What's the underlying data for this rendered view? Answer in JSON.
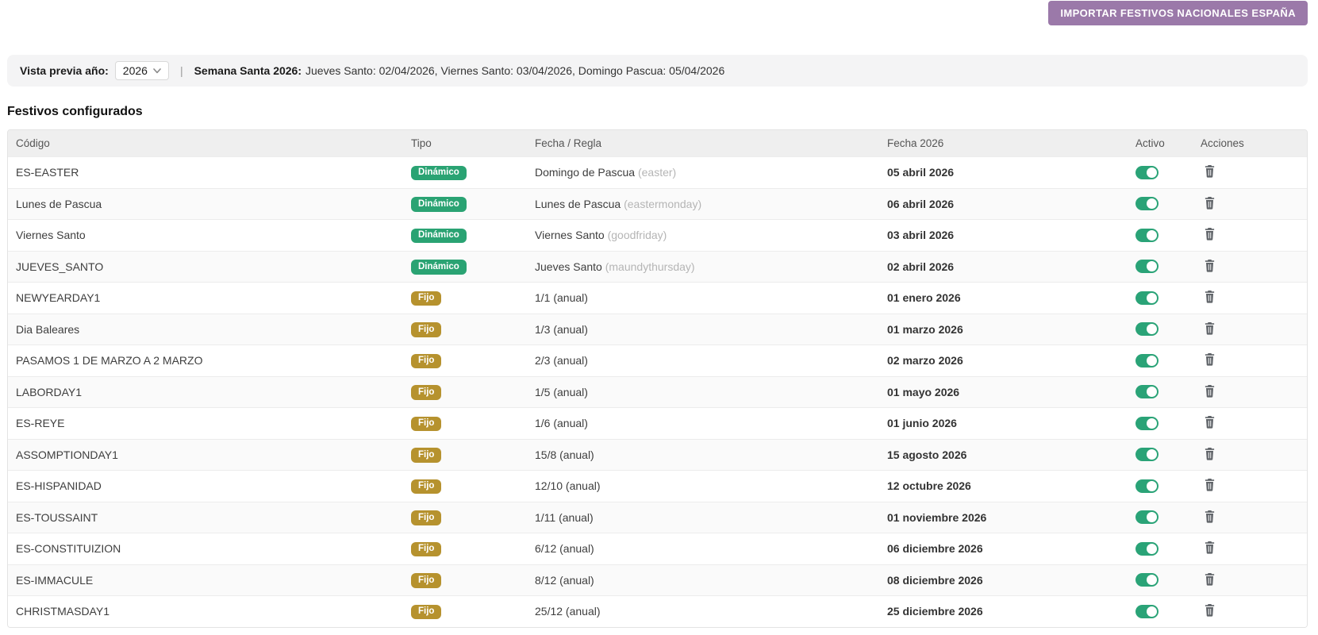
{
  "import_button": {
    "label": "IMPORTAR FESTIVOS NACIONALES ESPAÑA"
  },
  "preview": {
    "label": "Vista previa año:",
    "year": "2026",
    "separator": "|",
    "semana_santa_label": "Semana Santa 2026:",
    "semana_santa_text": "Jueves Santo: 02/04/2026, Viernes Santo: 03/04/2026, Domingo Pascua: 05/04/2026"
  },
  "section_title": "Festivos configurados",
  "table": {
    "headers": [
      "Código",
      "Tipo",
      "Fecha / Regla",
      "Fecha 2026",
      "Activo",
      "Acciones"
    ],
    "rows": [
      {
        "code": "ES-EASTER",
        "badge": {
          "label": "Dinámico",
          "style": "dinamico"
        },
        "rule": "Domingo de Pascua",
        "hint": "(easter)",
        "date": "05 abril 2026",
        "active": true
      },
      {
        "code": "Lunes de Pascua",
        "badge": {
          "label": "Dinámico",
          "style": "dinamico"
        },
        "rule": "Lunes de Pascua",
        "hint": "(eastermonday)",
        "date": "06 abril 2026",
        "active": true
      },
      {
        "code": "Viernes Santo",
        "badge": {
          "label": "Dinámico",
          "style": "dinamico"
        },
        "rule": "Viernes Santo",
        "hint": "(goodfriday)",
        "date": "03 abril 2026",
        "active": true
      },
      {
        "code": "JUEVES_SANTO",
        "badge": {
          "label": "Dinámico",
          "style": "dinamico"
        },
        "rule": "Jueves Santo",
        "hint": "(maundythursday)",
        "date": "02 abril 2026",
        "active": true
      },
      {
        "code": "NEWYEARDAY1",
        "badge": {
          "label": "Fijo",
          "style": "fijo"
        },
        "rule": "1/1 (anual)",
        "hint": "",
        "date": "01 enero 2026",
        "active": true
      },
      {
        "code": "Dia Baleares",
        "badge": {
          "label": "Fijo",
          "style": "fijo"
        },
        "rule": "1/3 (anual)",
        "hint": "",
        "date": "01 marzo 2026",
        "active": true
      },
      {
        "code": "PASAMOS 1 DE MARZO A 2 MARZO",
        "badge": {
          "label": "Fijo",
          "style": "fijo"
        },
        "rule": "2/3 (anual)",
        "hint": "",
        "date": "02 marzo 2026",
        "active": true
      },
      {
        "code": "LABORDAY1",
        "badge": {
          "label": "Fijo",
          "style": "fijo"
        },
        "rule": "1/5 (anual)",
        "hint": "",
        "date": "01 mayo 2026",
        "active": true
      },
      {
        "code": "ES-REYE",
        "badge": {
          "label": "Fijo",
          "style": "fijo"
        },
        "rule": "1/6 (anual)",
        "hint": "",
        "date": "01 junio 2026",
        "active": true
      },
      {
        "code": "ASSOMPTIONDAY1",
        "badge": {
          "label": "Fijo",
          "style": "fijo"
        },
        "rule": "15/8 (anual)",
        "hint": "",
        "date": "15 agosto 2026",
        "active": true
      },
      {
        "code": "ES-HISPANIDAD",
        "badge": {
          "label": "Fijo",
          "style": "fijo"
        },
        "rule": "12/10 (anual)",
        "hint": "",
        "date": "12 octubre 2026",
        "active": true
      },
      {
        "code": "ES-TOUSSAINT",
        "badge": {
          "label": "Fijo",
          "style": "fijo"
        },
        "rule": "1/11 (anual)",
        "hint": "",
        "date": "01 noviembre 2026",
        "active": true
      },
      {
        "code": "ES-CONSTITUIZION",
        "badge": {
          "label": "Fijo",
          "style": "fijo"
        },
        "rule": "6/12 (anual)",
        "hint": "",
        "date": "06 diciembre 2026",
        "active": true
      },
      {
        "code": "ES-IMMACULE",
        "badge": {
          "label": "Fijo",
          "style": "fijo"
        },
        "rule": "8/12 (anual)",
        "hint": "",
        "date": "08 diciembre 2026",
        "active": true
      },
      {
        "code": "CHRISTMASDAY1",
        "badge": {
          "label": "Fijo",
          "style": "fijo"
        },
        "rule": "25/12 (anual)",
        "hint": "",
        "date": "25 diciembre 2026",
        "active": true
      }
    ]
  },
  "colors": {
    "button": "#9b79a9",
    "badge_dinamico": "#2aa373",
    "badge_fijo": "#b6922e",
    "toggle_on": "#2aa377",
    "trash_icon": "#5f6368"
  }
}
